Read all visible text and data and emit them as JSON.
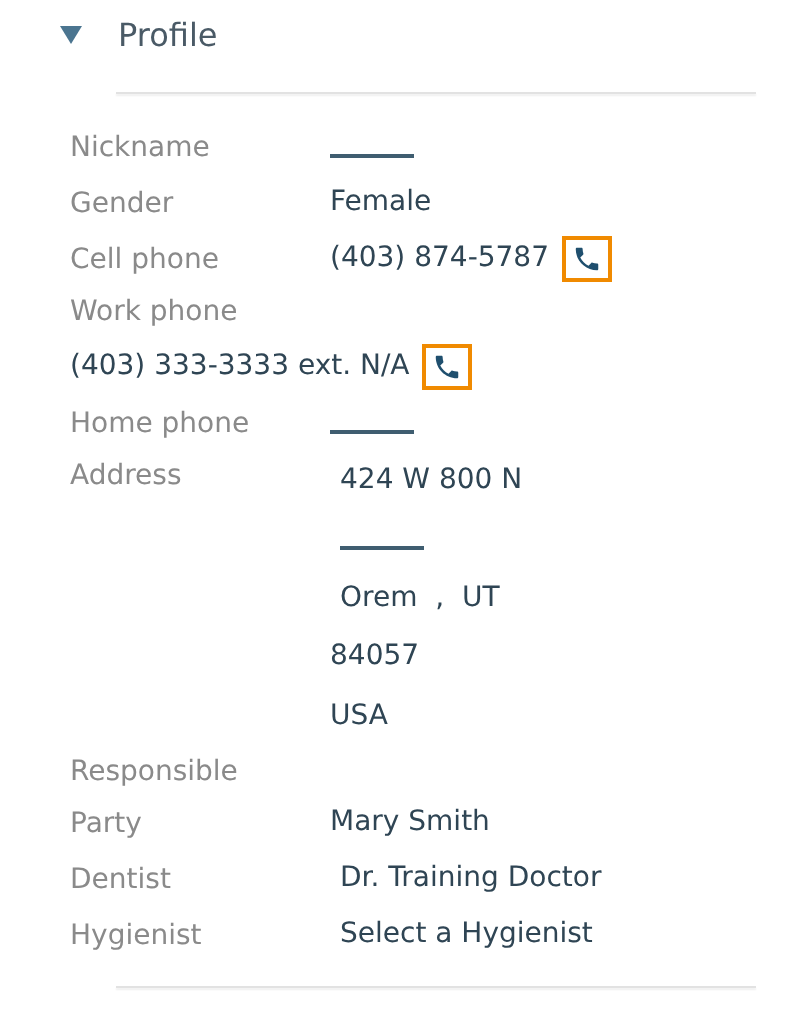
{
  "section": {
    "title": "Profile",
    "expanded": true
  },
  "fields": [
    {
      "kind": "inline",
      "label": "Nickname",
      "lines": [
        {
          "kind": "blank"
        }
      ]
    },
    {
      "kind": "inline",
      "label": "Gender",
      "lines": [
        {
          "kind": "text",
          "text": "Female"
        }
      ]
    },
    {
      "kind": "inline",
      "label": "Cell phone",
      "lines": [
        {
          "kind": "phone",
          "text": "(403) 874-5787",
          "highlighted": true
        }
      ]
    },
    {
      "kind": "stacked",
      "label": "Work phone",
      "lines": [
        {
          "kind": "phone",
          "text": "(403) 333-3333 ext. N/A",
          "highlighted": true
        }
      ]
    },
    {
      "kind": "inline",
      "label": "Home phone",
      "lines": [
        {
          "kind": "blank"
        }
      ]
    },
    {
      "kind": "address",
      "label": "Address",
      "lines": [
        {
          "kind": "text",
          "text": "424 W 800 N",
          "inset": true
        },
        {
          "kind": "blank",
          "inset": true
        },
        {
          "kind": "text",
          "text": "Orem  ,  UT",
          "inset": true
        },
        {
          "kind": "text",
          "text": "84057"
        },
        {
          "kind": "text",
          "text": "USA"
        }
      ]
    },
    {
      "kind": "inline",
      "label": "Responsible Party",
      "lines": [
        {
          "kind": "text",
          "text": "Mary Smith"
        }
      ]
    },
    {
      "kind": "inline",
      "label": "Dentist",
      "lines": [
        {
          "kind": "text",
          "text": "Dr. Training Doctor",
          "inset": true
        }
      ]
    },
    {
      "kind": "inline",
      "label": "Hygienist",
      "lines": [
        {
          "kind": "text",
          "text": "Select a Hygienist",
          "inset": true
        }
      ]
    }
  ]
}
